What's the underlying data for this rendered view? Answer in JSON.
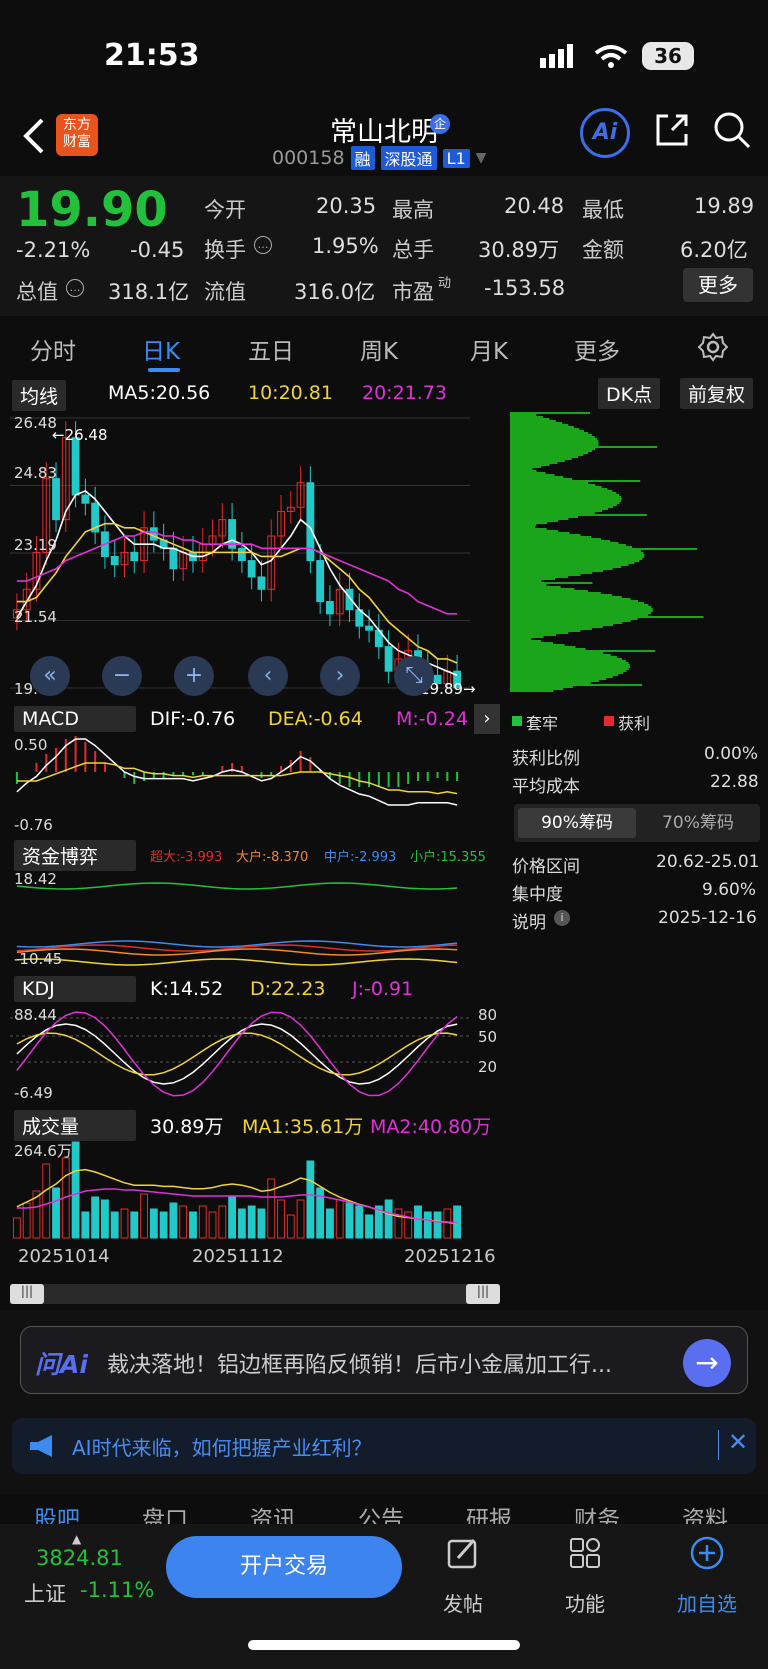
{
  "status": {
    "time": "21:53",
    "battery": "36"
  },
  "header": {
    "title": "常山北明",
    "code": "000158",
    "tags": [
      "融",
      "深股通",
      "L1"
    ],
    "brand": "东方\n财富",
    "ai": "Ai"
  },
  "quote": {
    "price": "19.90",
    "change_pct": "-2.21%",
    "change": "-0.45",
    "open_label": "今开",
    "open": "20.35",
    "high_label": "最高",
    "high": "20.48",
    "low_label": "最低",
    "low": "19.89",
    "turnover_label": "换手",
    "turnover": "1.95%",
    "volume_label": "总手",
    "volume": "30.89万",
    "amount_label": "金额",
    "amount": "6.20亿",
    "mktcap_label": "总值",
    "mktcap": "318.1亿",
    "float_label": "流值",
    "float": "316.0亿",
    "pe_label": "市盈",
    "pe_sup": "动",
    "pe": "-153.58",
    "more": "更多"
  },
  "tabs": [
    "分时",
    "日K",
    "五日",
    "周K",
    "月K",
    "更多"
  ],
  "ma": {
    "selector": "均线",
    "ma5": "MA5:20.56",
    "ma10": "10:20.81",
    "ma20": "20:21.73",
    "dk": "DK点",
    "fq": "前复权"
  },
  "kchart": {
    "y_labels": [
      "26.48",
      "24.83",
      "23.19",
      "21.54",
      "19.89"
    ],
    "max_marker": "←26.48",
    "min_marker": "19.89→"
  },
  "macd": {
    "selector": "MACD",
    "dif": "DIF:-0.76",
    "dea": "DEA:-0.64",
    "m": "M:-0.24",
    "top": "0.50",
    "bottom": "-0.76"
  },
  "fund": {
    "selector": "资金博弈",
    "super": "超大:-3.993",
    "big": "大户:-8.370",
    "mid": "中户:-2.993",
    "small": "小户:15.355",
    "top": "18.42",
    "bottom": "-10.45"
  },
  "kdj": {
    "selector": "KDJ",
    "k": "K:14.52",
    "d": "D:22.23",
    "j": "J:-0.91",
    "top": "88.44",
    "bottom": "-6.49",
    "lvls": [
      "80",
      "50",
      "20"
    ]
  },
  "vol": {
    "selector": "成交量",
    "vol": "30.89万",
    "ma1": "MA1:35.61万",
    "ma2": "MA2:40.80万",
    "top": "264.6万"
  },
  "dates": [
    "20251014",
    "20251112",
    "20251216"
  ],
  "chips": {
    "legend_trapped": "套牢",
    "legend_profit": "获利",
    "rows": [
      [
        "获利比例",
        "0.00%"
      ],
      [
        "平均成本",
        "22.88"
      ]
    ],
    "tab90": "90%筹码",
    "tab70": "70%筹码",
    "rows2": [
      [
        "价格区间",
        "20.62-25.01"
      ],
      [
        "集中度",
        "9.60%"
      ],
      [
        "说明",
        "2025-12-16"
      ]
    ]
  },
  "ai_bar": {
    "logo": "问Ai",
    "text": "裁决落地！铝边框再陷反倾销！后市小金属加工行..."
  },
  "notice": "AI时代来临，如何把握产业红利？",
  "subtabs": [
    "股吧",
    "盘口",
    "资讯",
    "公告",
    "研报",
    "财务",
    "资料"
  ],
  "bottom": {
    "index_value": "3824.81",
    "index_name": "上证",
    "index_change": "-1.11%",
    "trade": "开户交易",
    "post": "发帖",
    "func": "功能",
    "add": "加自选"
  },
  "chart_data": {
    "type": "candlestick",
    "x_start": "20251014",
    "x_mid": "20251112",
    "x_end": "20251216",
    "ohlc_close": [
      21.8,
      22.3,
      23.2,
      25.0,
      24.0,
      26.0,
      24.6,
      24.4,
      23.7,
      23.1,
      22.9,
      23.2,
      23.0,
      23.8,
      23.5,
      23.3,
      22.8,
      23.2,
      23.0,
      23.4,
      23.6,
      24.0,
      23.3,
      23.0,
      22.6,
      22.3,
      23.6,
      24.2,
      24.3,
      24.9,
      23.0,
      22.0,
      21.7,
      22.3,
      21.8,
      21.4,
      21.3,
      20.9,
      20.3,
      20.6,
      20.8,
      20.4,
      20.2,
      20.0,
      20.3,
      19.9
    ],
    "ma5": [
      21.6,
      22.0,
      22.4,
      23.0,
      23.5,
      24.2,
      24.6,
      24.7,
      24.5,
      24.2,
      23.9,
      23.6,
      23.4,
      23.4,
      23.4,
      23.3,
      23.3,
      23.2,
      23.1,
      23.1,
      23.2,
      23.4,
      23.5,
      23.4,
      23.2,
      22.9,
      23.0,
      23.3,
      23.6,
      24.0,
      23.8,
      23.3,
      22.8,
      22.4,
      22.1,
      21.8,
      21.6,
      21.3,
      21.0,
      20.8,
      20.7,
      20.6,
      20.5,
      20.4,
      20.3,
      20.2
    ],
    "ma10": [
      22.0,
      22.0,
      22.1,
      22.4,
      22.7,
      23.1,
      23.4,
      23.7,
      23.8,
      23.9,
      23.9,
      23.8,
      23.8,
      23.7,
      23.6,
      23.5,
      23.4,
      23.3,
      23.2,
      23.2,
      23.2,
      23.2,
      23.2,
      23.2,
      23.2,
      23.1,
      23.1,
      23.1,
      23.2,
      23.3,
      23.3,
      23.2,
      23.0,
      22.8,
      22.6,
      22.3,
      22.1,
      21.8,
      21.5,
      21.3,
      21.1,
      20.9,
      20.8,
      20.6,
      20.6,
      20.5
    ],
    "ma20": [
      22.5,
      22.5,
      22.6,
      22.7,
      22.8,
      23.0,
      23.1,
      23.2,
      23.3,
      23.4,
      23.5,
      23.6,
      23.6,
      23.7,
      23.7,
      23.6,
      23.6,
      23.5,
      23.5,
      23.4,
      23.4,
      23.4,
      23.4,
      23.4,
      23.4,
      23.3,
      23.3,
      23.3,
      23.3,
      23.3,
      23.3,
      23.2,
      23.1,
      23.0,
      22.9,
      22.8,
      22.7,
      22.6,
      22.5,
      22.3,
      22.2,
      22.0,
      21.9,
      21.8,
      21.7,
      21.7
    ],
    "y_range": [
      19.89,
      26.48
    ]
  }
}
